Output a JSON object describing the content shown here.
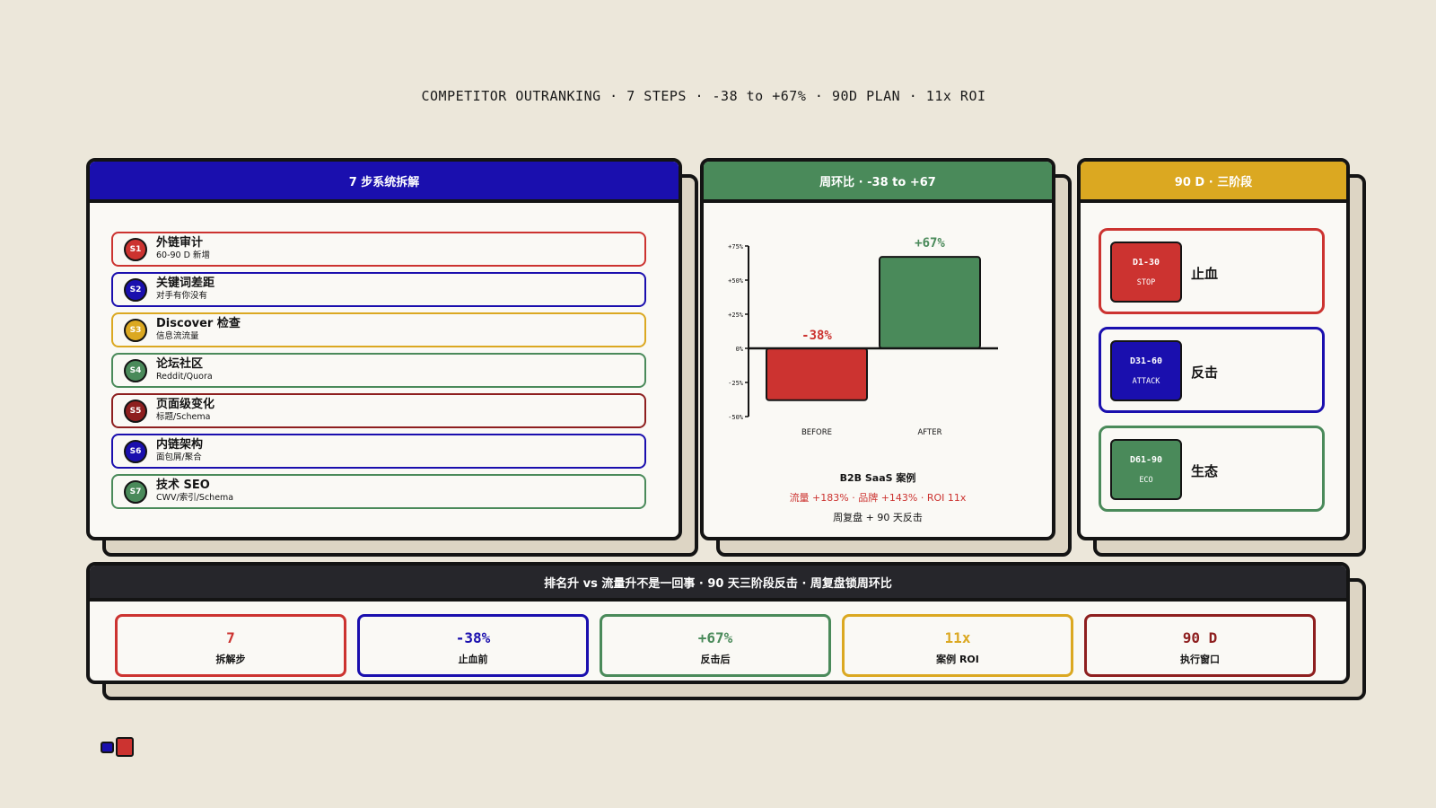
{
  "title": "COMPETITOR OUTRANKING · 7 STEPS · -38 to +67% · 90D PLAN · 11x ROI",
  "colors": {
    "blue": "#1A0FAE",
    "green": "#4A8A5A",
    "yellow": "#DBA821",
    "red": "#CC3330",
    "darkred": "#8E1F1F",
    "dark": "#26262B"
  },
  "steps_panel": {
    "header": "7 步系统拆解",
    "steps": [
      {
        "id": "S1",
        "title": "外链审计",
        "sub": "60-90 D 新增",
        "color": "#CC3330"
      },
      {
        "id": "S2",
        "title": "关键词差距",
        "sub": "对手有你没有",
        "color": "#1A0FAE"
      },
      {
        "id": "S3",
        "title": "Discover 检查",
        "sub": "信息流流量",
        "color": "#DBA821"
      },
      {
        "id": "S4",
        "title": "论坛社区",
        "sub": "Reddit/Quora",
        "color": "#4A8A5A"
      },
      {
        "id": "S5",
        "title": "页面级变化",
        "sub": "标题/Schema",
        "color": "#8E1F1F"
      },
      {
        "id": "S6",
        "title": "内链架构",
        "sub": "面包屑/聚合",
        "color": "#1A0FAE"
      },
      {
        "id": "S7",
        "title": "技术 SEO",
        "sub": "CWV/索引/Schema",
        "color": "#4A8A5A"
      }
    ]
  },
  "chart_panel": {
    "header": "周环比 · -38 to +67",
    "caption_title": "B2B SaaS 案例",
    "caption_red": "流量 +183% · 品牌 +143% · ROI 11x",
    "caption_note": "周复盘 + 90 天反击"
  },
  "chart_data": {
    "type": "bar",
    "categories": [
      "BEFORE",
      "AFTER"
    ],
    "values": [
      -38,
      67
    ],
    "value_labels": [
      "-38%",
      "+67%"
    ],
    "colors": [
      "#CC3330",
      "#4A8A5A"
    ],
    "ylim": [
      -50,
      75
    ],
    "yticks": [
      75,
      50,
      25,
      0,
      -25,
      -50
    ],
    "ytick_labels": [
      "+75%",
      "+50%",
      "+25%",
      "0%",
      "-25%",
      "-50%"
    ],
    "title": "",
    "xlabel": "",
    "ylabel": ""
  },
  "phases_panel": {
    "header": "90 D · 三阶段",
    "phases": [
      {
        "range": "D1-30",
        "code": "STOP",
        "name": "止血",
        "color": "#CC3330"
      },
      {
        "range": "D31-60",
        "code": "ATTACK",
        "name": "反击",
        "color": "#1A0FAE"
      },
      {
        "range": "D61-90",
        "code": "ECO",
        "name": "生态",
        "color": "#4A8A5A"
      }
    ]
  },
  "summary": {
    "header": "排名升 vs 流量升不是一回事 · 90 天三阶段反击 · 周复盘锁周环比",
    "stats": [
      {
        "value": "7",
        "label": "拆解步",
        "color": "#CC3330"
      },
      {
        "value": "-38%",
        "label": "止血前",
        "color": "#1A0FAE"
      },
      {
        "value": "+67%",
        "label": "反击后",
        "color": "#4A8A5A"
      },
      {
        "value": "11x",
        "label": "案例 ROI",
        "color": "#DBA821"
      },
      {
        "value": "90 D",
        "label": "执行窗口",
        "color": "#8E1F1F"
      }
    ]
  }
}
